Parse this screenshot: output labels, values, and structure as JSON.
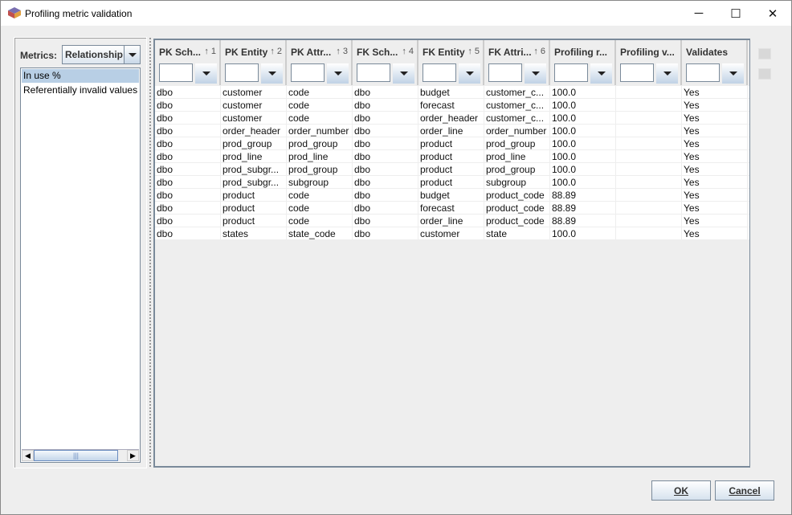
{
  "window": {
    "title": "Profiling metric validation",
    "minimize": "─",
    "maximize": "☐",
    "close": "✕"
  },
  "left": {
    "metrics_label": "Metrics:",
    "metrics_value": "Relationship",
    "items": [
      "In use %",
      "Referentially invalid values"
    ],
    "selected": 0
  },
  "table": {
    "columns": [
      {
        "label": "PK Sch...",
        "sort": "↑ 1"
      },
      {
        "label": "PK Entity",
        "sort": "↑ 2"
      },
      {
        "label": "PK Attr...",
        "sort": "↑ 3"
      },
      {
        "label": "FK Sch...",
        "sort": "↑ 4"
      },
      {
        "label": "FK Entity",
        "sort": "↑ 5"
      },
      {
        "label": "FK Attri...",
        "sort": "↑ 6"
      },
      {
        "label": "Profiling r...",
        "sort": ""
      },
      {
        "label": "Profiling v...",
        "sort": ""
      },
      {
        "label": "Validates",
        "sort": ""
      }
    ],
    "rows": [
      [
        "dbo",
        "customer",
        "code",
        "dbo",
        "budget",
        "customer_c...",
        "100.0",
        "",
        "Yes"
      ],
      [
        "dbo",
        "customer",
        "code",
        "dbo",
        "forecast",
        "customer_c...",
        "100.0",
        "",
        "Yes"
      ],
      [
        "dbo",
        "customer",
        "code",
        "dbo",
        "order_header",
        "customer_c...",
        "100.0",
        "",
        "Yes"
      ],
      [
        "dbo",
        "order_header",
        "order_number",
        "dbo",
        "order_line",
        "order_number",
        "100.0",
        "",
        "Yes"
      ],
      [
        "dbo",
        "prod_group",
        "prod_group",
        "dbo",
        "product",
        "prod_group",
        "100.0",
        "",
        "Yes"
      ],
      [
        "dbo",
        "prod_line",
        "prod_line",
        "dbo",
        "product",
        "prod_line",
        "100.0",
        "",
        "Yes"
      ],
      [
        "dbo",
        "prod_subgr...",
        "prod_group",
        "dbo",
        "product",
        "prod_group",
        "100.0",
        "",
        "Yes"
      ],
      [
        "dbo",
        "prod_subgr...",
        "subgroup",
        "dbo",
        "product",
        "subgroup",
        "100.0",
        "",
        "Yes"
      ],
      [
        "dbo",
        "product",
        "code",
        "dbo",
        "budget",
        "product_code",
        "88.89",
        "",
        "Yes"
      ],
      [
        "dbo",
        "product",
        "code",
        "dbo",
        "forecast",
        "product_code",
        "88.89",
        "",
        "Yes"
      ],
      [
        "dbo",
        "product",
        "code",
        "dbo",
        "order_line",
        "product_code",
        "88.89",
        "",
        "Yes"
      ],
      [
        "dbo",
        "states",
        "state_code",
        "dbo",
        "customer",
        "state",
        "100.0",
        "",
        "Yes"
      ]
    ]
  },
  "buttons": {
    "ok": "OK",
    "cancel": "Cancel"
  }
}
